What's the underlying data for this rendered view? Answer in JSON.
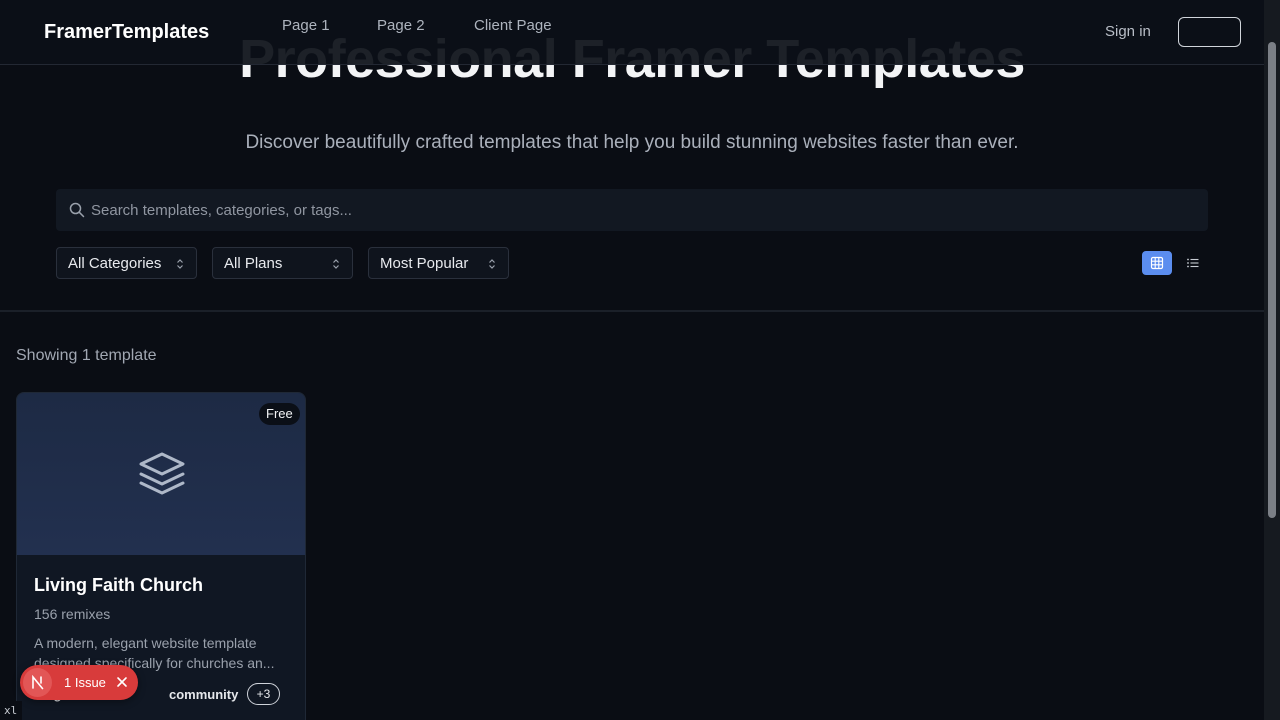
{
  "navbar": {
    "brand": "FramerTemplates",
    "links": [
      "Page 1",
      "Page 2",
      "Client Page"
    ],
    "sign_in": "Sign in"
  },
  "hero": {
    "title": "Professional Framer Templates",
    "subtitle": "Discover beautifully crafted templates that help you build stunning websites faster than ever."
  },
  "search": {
    "placeholder": "Search templates, categories, or tags...",
    "icon": "search-icon"
  },
  "filters": {
    "category": "All Categories",
    "plan": "All Plans",
    "sort": "Most Popular"
  },
  "view": {
    "active": "grid"
  },
  "results": {
    "count_text": "Showing 1 template"
  },
  "cards": [
    {
      "badge": "Free",
      "title": "Living Faith Church",
      "remixes": "156 remixes",
      "description": "A modern, elegant website template designed specifically for churches an...",
      "tags": [
        "religion",
        "community"
      ],
      "more_tags": "+3",
      "thumb_icon": "layers-icon"
    }
  ],
  "issue_pill": {
    "text": "1 Issue"
  },
  "breakpoint_badge": "xl",
  "colors": {
    "accent": "#5b8def",
    "issue": "#d83b3b",
    "background": "#0a0d14"
  }
}
